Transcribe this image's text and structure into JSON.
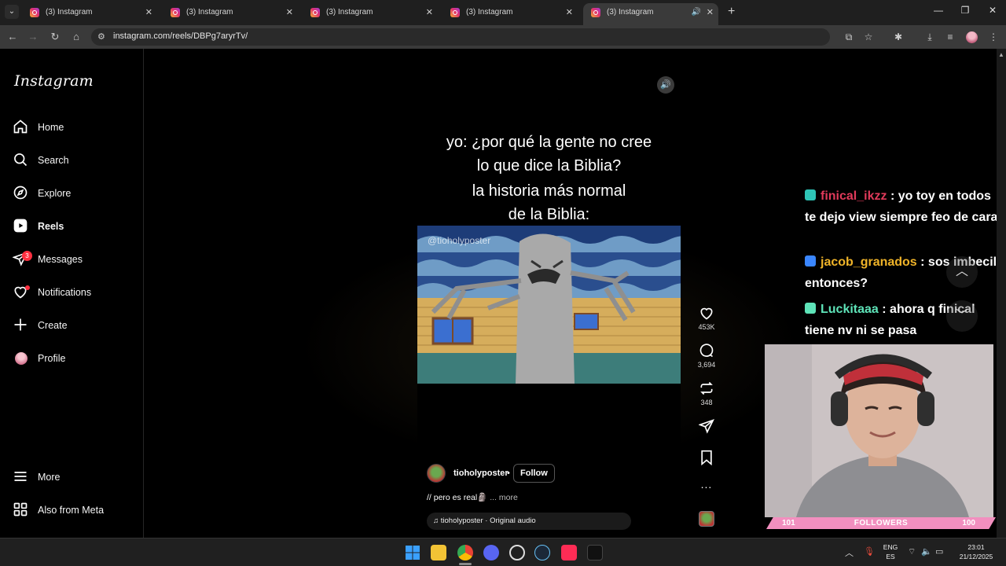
{
  "browser": {
    "tabs": [
      {
        "title": "(3) Instagram",
        "active": false
      },
      {
        "title": "(3) Instagram",
        "active": false
      },
      {
        "title": "(3) Instagram",
        "active": false
      },
      {
        "title": "(3) Instagram",
        "active": false
      },
      {
        "title": "(3) Instagram",
        "active": true,
        "audio": true
      }
    ],
    "url": "instagram.com/reels/DBPg7aryrTv/"
  },
  "sidebar": {
    "logo": "Instagram",
    "items": [
      {
        "label": "Home",
        "icon": "home-icon"
      },
      {
        "label": "Search",
        "icon": "search-icon"
      },
      {
        "label": "Explore",
        "icon": "explore-icon"
      },
      {
        "label": "Reels",
        "icon": "reels-icon",
        "active": true
      },
      {
        "label": "Messages",
        "icon": "messages-icon",
        "badge": "3"
      },
      {
        "label": "Notifications",
        "icon": "heart-icon",
        "dot": true
      },
      {
        "label": "Create",
        "icon": "plus-icon"
      },
      {
        "label": "Profile",
        "icon": "avatar"
      }
    ],
    "bottom": [
      {
        "label": "More",
        "icon": "menu-icon"
      },
      {
        "label": "Also from Meta",
        "icon": "meta-grid-icon"
      }
    ]
  },
  "reel": {
    "caption_line1": "yo: ¿por qué la gente no cree",
    "caption_line2": "lo que dice la Biblia?",
    "caption_line3": "la historia más normal",
    "caption_line4": "de la Biblia:",
    "watermark": "@tioholyposter",
    "author": "tioholyposter",
    "author_sep": "•",
    "follow_label": "Follow",
    "description": "// pero es real🗿",
    "more_label": "... more",
    "audio": "tioholyposter · Original audio",
    "likes": "453K",
    "comments": "3,694",
    "reposts": "348",
    "more_actions": "..."
  },
  "stream": {
    "chat": [
      {
        "user": "finical_ikzz",
        "text": ": yo toy en todos te dejo view siempre feo de cara",
        "badge_color": "#2ec4b6"
      },
      {
        "user": "jacob_granados",
        "text": ": sos imbecil entonces?",
        "badge_color": "#3a86ff"
      },
      {
        "user": "Luckitaaa",
        "text": ": ahora q finical tiene nv ni se pasa",
        "badge_color": "#5ee3b8"
      }
    ],
    "followers_left": "101",
    "followers_label": "FOLLOWERS",
    "followers_right": "100"
  },
  "taskbar": {
    "lang_top": "ENG",
    "lang_bottom": "ES",
    "time": "23:01",
    "date": "21/12/2025"
  }
}
